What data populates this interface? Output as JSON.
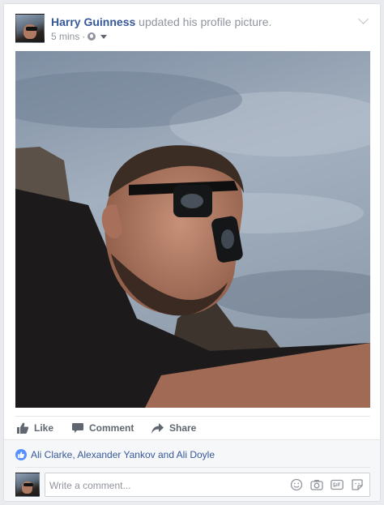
{
  "post": {
    "author": "Harry Guinness",
    "action_text": "updated his profile picture.",
    "time": "5 mins",
    "separator": "·",
    "privacy_icon": "globe-icon",
    "options_icon": "chevron-down-icon"
  },
  "actions": {
    "like_label": "Like",
    "comment_label": "Comment",
    "share_label": "Share"
  },
  "reactions": {
    "icon": "thumbs-up-icon",
    "text": "Ali Clarke, Alexander Yankov and Ali Doyle"
  },
  "comment_input": {
    "placeholder": "Write a comment...",
    "icons": [
      "emoji-icon",
      "camera-icon",
      "gif-icon",
      "sticker-icon"
    ]
  },
  "colors": {
    "link": "#365899",
    "muted": "#90949c",
    "action": "#606770",
    "like_badge": "#5890ff",
    "background": "#e9ebee"
  }
}
